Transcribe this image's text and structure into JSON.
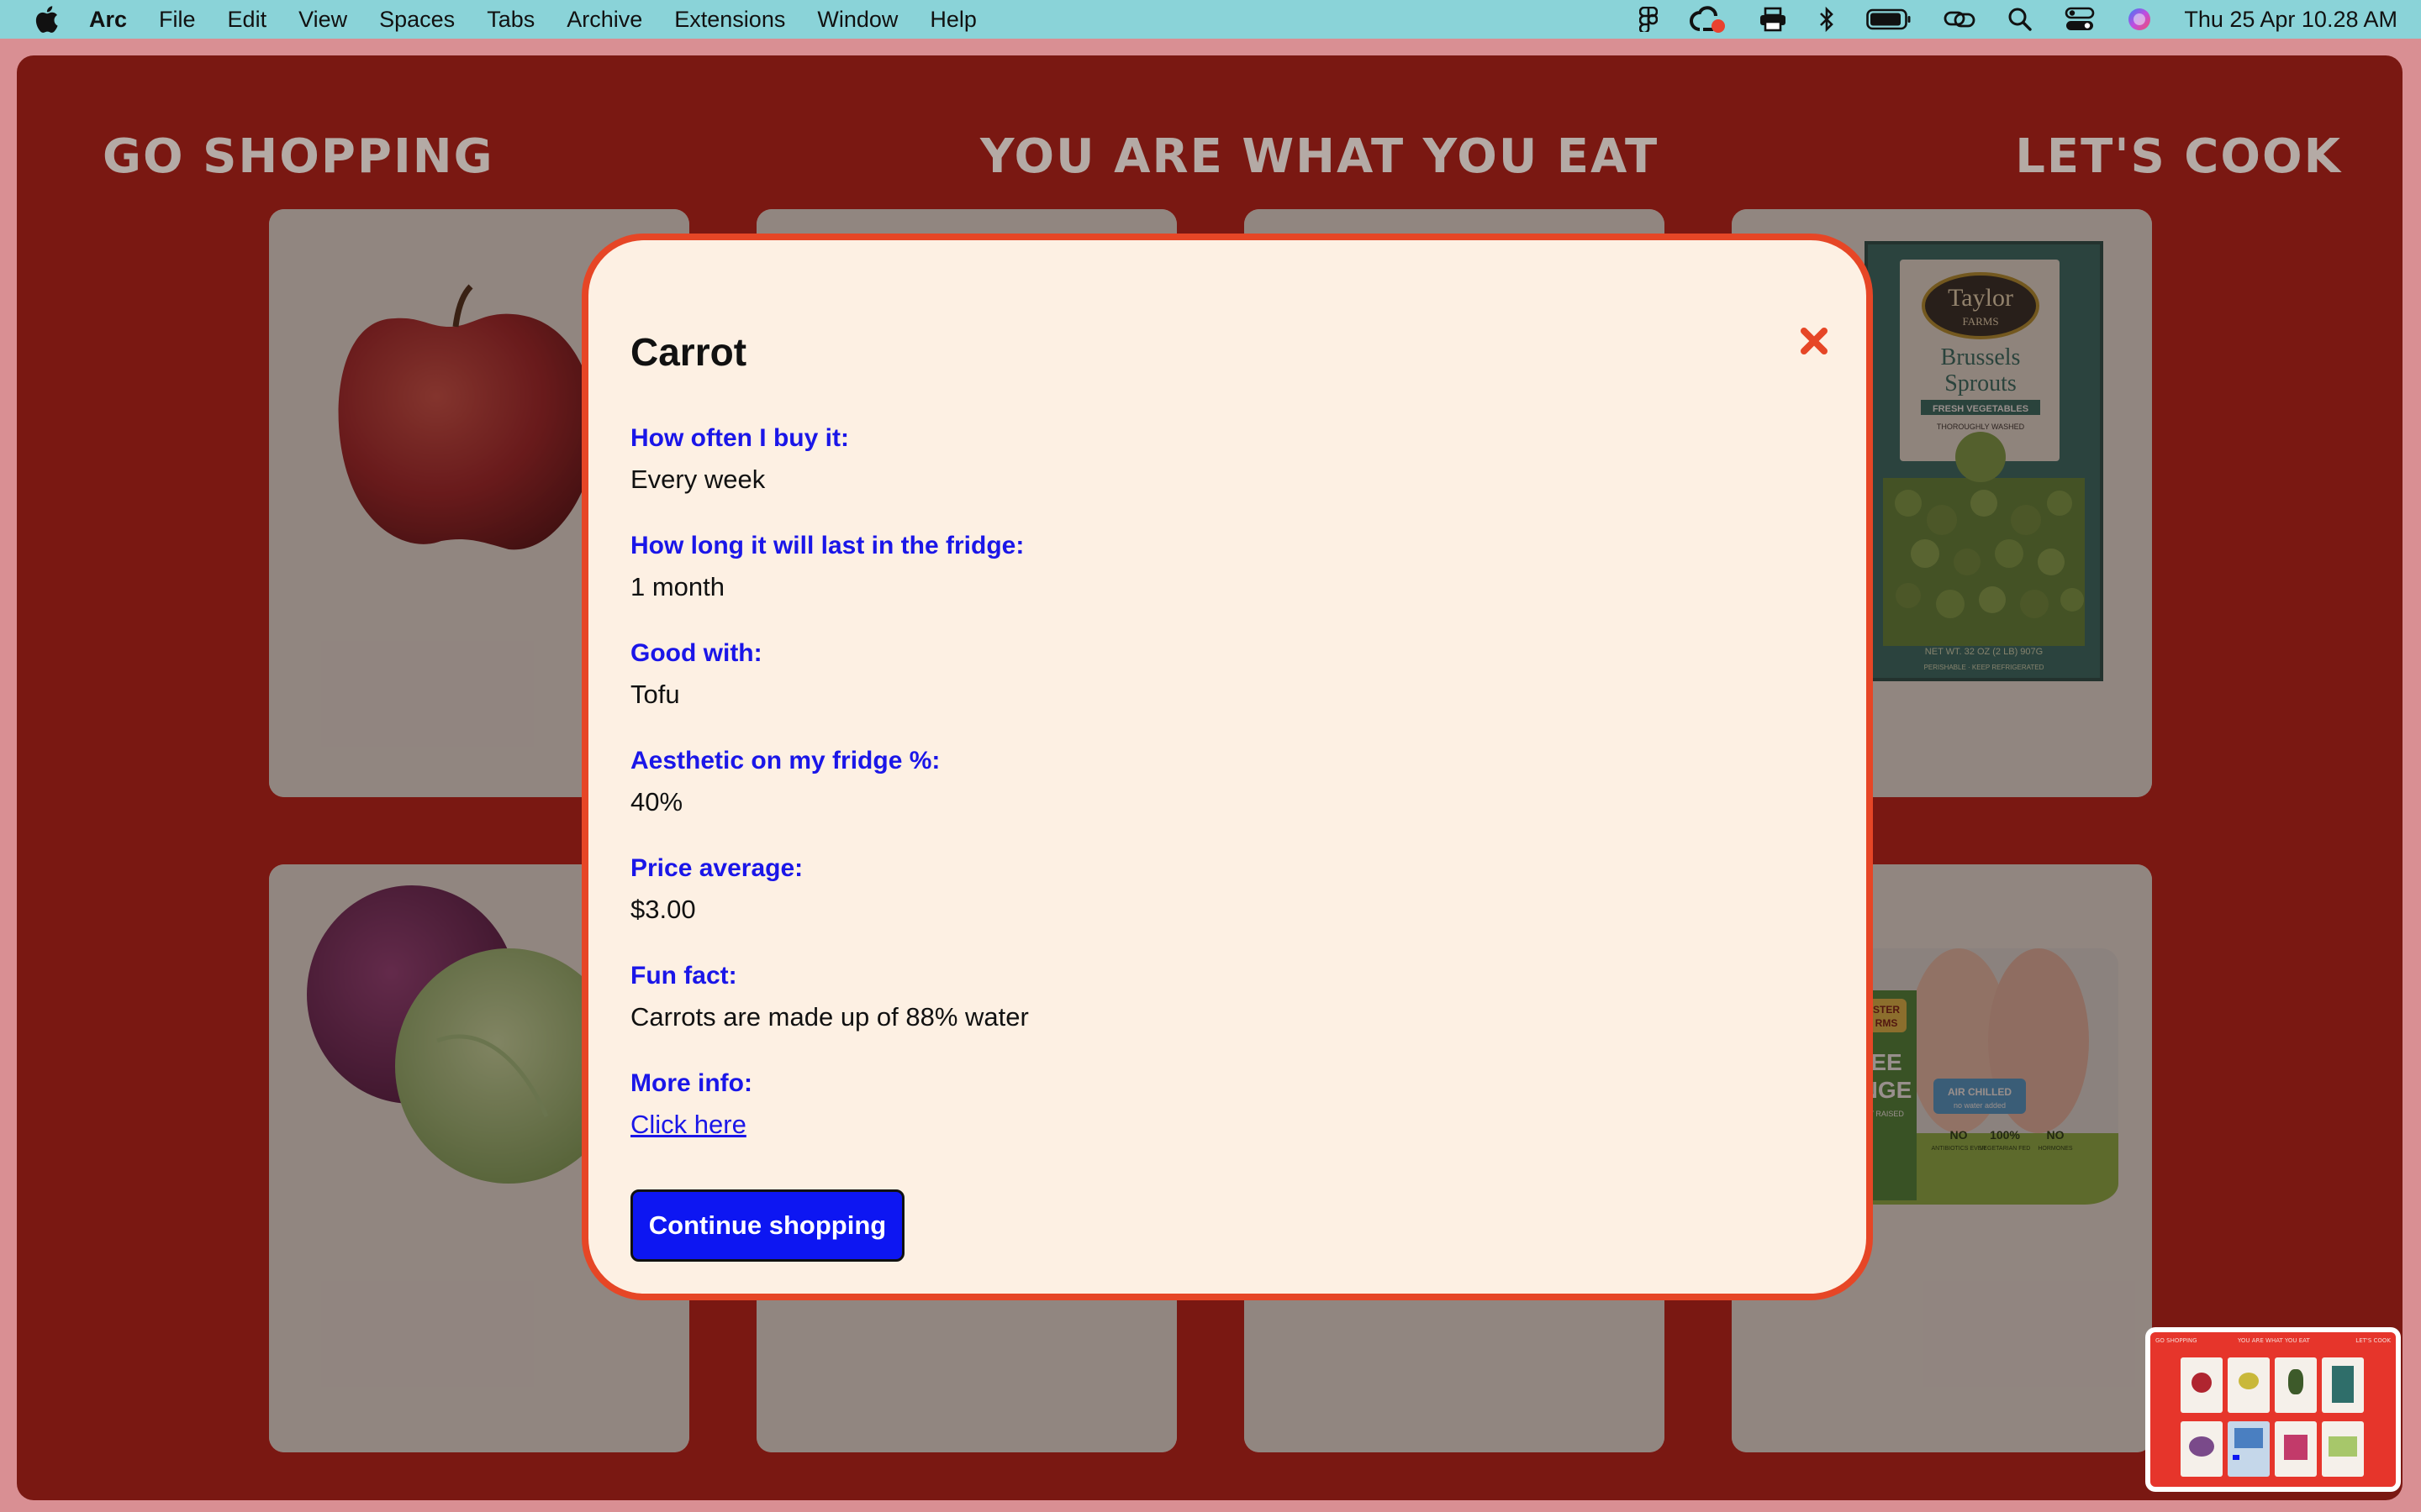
{
  "menubar": {
    "app_name": "Arc",
    "items": [
      "File",
      "Edit",
      "View",
      "Spaces",
      "Tabs",
      "Archive",
      "Extensions",
      "Window",
      "Help"
    ],
    "clock": "Thu 25 Apr  10.28 AM",
    "status_icons": [
      "figma-icon",
      "creative-cloud-icon",
      "printer-icon",
      "bluetooth-icon",
      "battery-icon",
      "link-icon",
      "search-icon",
      "control-center-icon",
      "siri-icon"
    ]
  },
  "site": {
    "nav_left": "GO SHOPPING",
    "nav_center": "YOU ARE WHAT YOU EAT",
    "nav_right": "LET'S COOK",
    "accent": "#7a1812"
  },
  "modal": {
    "title": "Carrot",
    "fields": [
      {
        "label": "How often I buy it:",
        "value": "Every week"
      },
      {
        "label": "How long it will last in the fridge:",
        "value": "1 month"
      },
      {
        "label": "Good with:",
        "value": "Tofu"
      },
      {
        "label": "Aesthetic on my fridge %:",
        "value": "40%"
      },
      {
        "label": "Price average:",
        "value": "$3.00"
      },
      {
        "label": "Fun fact:",
        "value": "Carrots are made up of 88% water"
      }
    ],
    "more_info": {
      "label": "More info:",
      "link_text": "Click here"
    },
    "button_label": "Continue shopping",
    "close_icon": "close-x-icon",
    "colors": {
      "label": "#1a16e8",
      "button": "#0d16f2",
      "border": "#e64626",
      "background": "#fdf0e3"
    }
  },
  "products": {
    "brussels": {
      "brand": "Taylor",
      "brand_sub": "FARMS",
      "name_line1": "Brussels",
      "name_line2": "Sprouts",
      "tag1": "FRESH VEGETABLES",
      "tag2": "THOROUGHLY WASHED",
      "net_wt": "NET WT. 32 OZ (2 LB) 907G",
      "perish": "PERISHABLE · KEEP REFRIGERATED"
    },
    "chicken": {
      "brand": "STER",
      "brand2": "RMS",
      "free": "EE",
      "range": "NGE",
      "raised": "Y RAISED",
      "air": "AIR CHILLED",
      "air_sub": "no water added",
      "badge1_big": "NO",
      "badge1_small": "ANTIBIOTICS EVER",
      "badge2_big": "100%",
      "badge2_small": "VEGETARIAN FED",
      "badge3_big": "NO",
      "badge3_small": "HORMONES"
    },
    "thumbnail": {
      "nav_left": "GO SHOPPING",
      "nav_center": "YOU ARE WHAT YOU EAT",
      "nav_right": "LET'S COOK"
    }
  }
}
